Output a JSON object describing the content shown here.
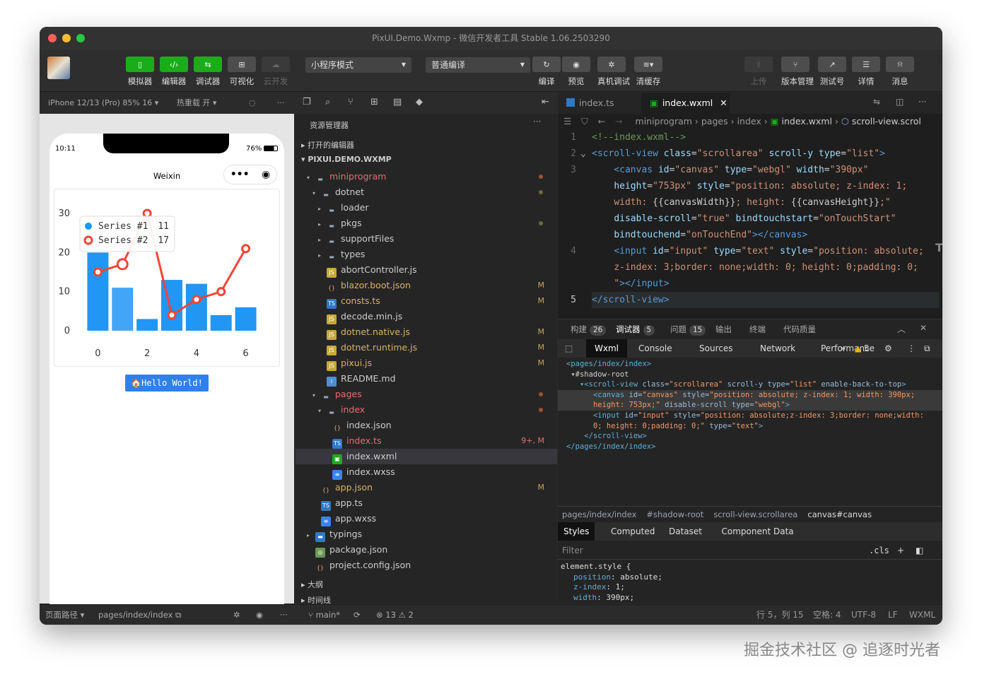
{
  "window": {
    "title": "PixUI.Demo.Wxmp - 微信开发者工具 Stable 1.06.2503290"
  },
  "toolbar": {
    "left": [
      {
        "label": "模拟器",
        "icon": "phone-icon"
      },
      {
        "label": "编辑器",
        "icon": "code-icon"
      },
      {
        "label": "调试器",
        "icon": "debug-icon"
      },
      {
        "label": "可视化",
        "icon": "layout-icon"
      },
      {
        "label": "云开发",
        "icon": "cloud-icon"
      }
    ],
    "mode_select": "小程序模式",
    "compile_select": "普通编译",
    "mid": [
      {
        "label": "编译",
        "icon": "refresh-icon"
      },
      {
        "label": "预览",
        "icon": "eye-icon"
      },
      {
        "label": "真机调试",
        "icon": "bug-icon"
      },
      {
        "label": "清缓存",
        "icon": "layers-icon"
      }
    ],
    "right": [
      {
        "label": "上传",
        "icon": "upload-icon"
      },
      {
        "label": "版本管理",
        "icon": "branch-icon"
      },
      {
        "label": "测试号",
        "icon": "external-icon"
      },
      {
        "label": "详情",
        "icon": "menu-icon"
      },
      {
        "label": "消息",
        "icon": "bell-icon"
      }
    ]
  },
  "simulator": {
    "device": "iPhone 12/13 (Pro) 85% 16 ▾",
    "hot_reload": "热重载 开 ▾",
    "time": "10:11",
    "battery": "76%",
    "nav_title": "Weixin",
    "hello_button": "🏠Hello World!",
    "footer_path_label": "页面路径 ▾",
    "footer_path": "pages/index/index"
  },
  "chart_data": {
    "type": "bar",
    "x": [
      0,
      1,
      2,
      3,
      4,
      5,
      6
    ],
    "xticks": [
      "0",
      "2",
      "4",
      "6"
    ],
    "yticks": [
      "0",
      "10",
      "20",
      "30"
    ],
    "ylim": [
      0,
      30
    ],
    "series": [
      {
        "name": "Series #1",
        "type": "bar",
        "values": [
          20,
          11,
          3,
          13,
          12,
          4,
          6
        ]
      },
      {
        "name": "Series #2",
        "type": "line",
        "values": [
          15,
          17,
          30,
          4,
          8,
          10,
          21
        ]
      }
    ],
    "tooltip": [
      {
        "label": "Series #1",
        "value": "11",
        "color": "#2196f3"
      },
      {
        "label": "Series #2",
        "value": "17",
        "color": "#f44336"
      }
    ]
  },
  "explorer": {
    "title": "资源管理器",
    "open_editors": "打开的编辑器",
    "project": "PIXUI.DEMO.WXMP",
    "items": [
      {
        "name": "miniprogram",
        "depth": 1,
        "arrow": "▾",
        "type": "folder",
        "color": "#e07070",
        "dot": true
      },
      {
        "name": "dotnet",
        "depth": 2,
        "arrow": "▾",
        "type": "folder",
        "color": "#ccc",
        "dot": true,
        "dotcolor": "#6b6b3a"
      },
      {
        "name": "loader",
        "depth": 3,
        "arrow": "▸",
        "type": "folder",
        "color": "#ccc"
      },
      {
        "name": "pkgs",
        "depth": 3,
        "arrow": "▸",
        "type": "folder",
        "color": "#ccc",
        "dot": true,
        "dotcolor": "#6b6b3a"
      },
      {
        "name": "supportFiles",
        "depth": 3,
        "arrow": "▸",
        "type": "folder",
        "color": "#ccc"
      },
      {
        "name": "types",
        "depth": 3,
        "arrow": "▸",
        "type": "folder",
        "color": "#ccc"
      },
      {
        "name": "abortController.js",
        "depth": 3,
        "type": "js",
        "color": "#ccc"
      },
      {
        "name": "blazor.boot.json",
        "depth": 3,
        "type": "json",
        "color": "#d9b26a",
        "status": "M"
      },
      {
        "name": "consts.ts",
        "depth": 3,
        "type": "ts",
        "color": "#d9b26a",
        "status": "M"
      },
      {
        "name": "decode.min.js",
        "depth": 3,
        "type": "js",
        "color": "#ccc"
      },
      {
        "name": "dotnet.native.js",
        "depth": 3,
        "type": "js",
        "color": "#d9b26a",
        "status": "M"
      },
      {
        "name": "dotnet.runtime.js",
        "depth": 3,
        "type": "js",
        "color": "#d9b26a",
        "status": "M"
      },
      {
        "name": "pixui.js",
        "depth": 3,
        "type": "js",
        "color": "#d9b26a",
        "status": "M"
      },
      {
        "name": "README.md",
        "depth": 3,
        "type": "md",
        "color": "#ccc"
      },
      {
        "name": "pages",
        "depth": 2,
        "arrow": "▾",
        "type": "folder",
        "color": "#e07070",
        "dot": true
      },
      {
        "name": "index",
        "depth": 3,
        "arrow": "▾",
        "type": "folder",
        "color": "#e07070",
        "dot": true
      },
      {
        "name": "index.json",
        "depth": 4,
        "type": "json",
        "color": "#ccc"
      },
      {
        "name": "index.ts",
        "depth": 4,
        "type": "ts",
        "color": "#e07070",
        "status": "9+, M",
        "statuscolor": "#e07070"
      },
      {
        "name": "index.wxml",
        "depth": 4,
        "type": "wxml",
        "color": "#ccc",
        "selected": true
      },
      {
        "name": "index.wxss",
        "depth": 4,
        "type": "wxss",
        "color": "#ccc"
      },
      {
        "name": "app.json",
        "depth": 2,
        "type": "json",
        "color": "#d9b26a",
        "status": "M"
      },
      {
        "name": "app.ts",
        "depth": 2,
        "type": "ts",
        "color": "#ccc"
      },
      {
        "name": "app.wxss",
        "depth": 2,
        "type": "wxss",
        "color": "#ccc"
      },
      {
        "name": "typings",
        "depth": 1,
        "arrow": "▸",
        "type": "tsfolder",
        "color": "#ccc"
      },
      {
        "name": "package.json",
        "depth": 1,
        "type": "pkg",
        "color": "#ccc"
      },
      {
        "name": "project.config.json",
        "depth": 1,
        "type": "json",
        "color": "#ccc"
      }
    ],
    "outline": "大纲",
    "timeline": "时间线",
    "branch": "main*",
    "problems": "⊗ 13 ⚠ 2"
  },
  "editor": {
    "tabs": [
      {
        "label": "index.ts",
        "active": false
      },
      {
        "label": "index.wxml",
        "active": true
      }
    ],
    "breadcrumb": [
      "miniprogram",
      "pages",
      "index",
      "index.wxml",
      "scroll-view.scrol"
    ],
    "lines": [
      {
        "n": "1",
        "html": "<span class='cm'>&lt;!--index.wxml--&gt;</span>"
      },
      {
        "n": "2",
        "html": "<span class='tg'>&lt;scroll-view</span> <span class='at'>class</span>=<span class='sv'>\"scrollarea\"</span> <span class='at'>scroll-y</span> <span class='at'>type</span>=<span class='sv'>\"list\"</span><span class='tg'>&gt;</span>"
      },
      {
        "n": "3",
        "html": "    <span class='tg'>&lt;canvas</span> <span class='at'>id</span>=<span class='sv'>\"canvas\"</span> <span class='at'>type</span>=<span class='sv'>\"webgl\"</span> <span class='at'>width</span>=<span class='sv'>\"390px\"</span>"
      },
      {
        "n": "",
        "html": "    <span class='at'>height</span>=<span class='sv'>\"753px\"</span> <span class='at'>style</span>=<span class='sv'>\"position: absolute; z-index: 1;</span>"
      },
      {
        "n": "",
        "html": "    <span class='sv'>width: </span>{{canvasWidth}}<span class='sv'>; height: </span>{{canvasHeight}}<span class='sv'>;\"</span>"
      },
      {
        "n": "",
        "html": "    <span class='at'>disable-scroll</span>=<span class='sv'>\"true\"</span> <span class='at'>bindtouchstart</span>=<span class='sv'>\"onTouchStart\"</span>"
      },
      {
        "n": "",
        "html": "    <span class='at'>bindtouchend</span>=<span class='sv'>\"onTouchEnd\"</span><span class='tg'>&gt;&lt;/canvas&gt;</span>"
      },
      {
        "n": "4",
        "html": "    <span class='tg'>&lt;input</span> <span class='at'>id</span>=<span class='sv'>\"input\"</span> <span class='at'>type</span>=<span class='sv'>\"text\"</span> <span class='at'>style</span>=<span class='sv'>\"position: absolute;</span>"
      },
      {
        "n": "",
        "html": "    <span class='sv'>z-index: 3;border: none;width: 0; height: 0;padding: 0;</span>"
      },
      {
        "n": "",
        "html": "    <span class='sv'>\"</span><span class='tg'>&gt;&lt;/input&gt;</span>"
      },
      {
        "n": "5",
        "html": "<span class='tg'>&lt;/scroll-view&gt;</span>"
      }
    ]
  },
  "panel": {
    "tabs": [
      {
        "label": "构建",
        "count": "26"
      },
      {
        "label": "调试器",
        "count": "5",
        "active": true
      },
      {
        "label": "问题",
        "count": "15"
      },
      {
        "label": "输出"
      },
      {
        "label": "终端"
      },
      {
        "label": "代码质量"
      }
    ],
    "devtabs": [
      "Wxml",
      "Console",
      "Sources",
      "Network",
      "Performance"
    ],
    "warn_count": "5",
    "dom_lines": [
      "<span class='dtag'>&lt;pages/index/index&gt;</span>",
      " <span style='color:#ccc'>▾#shadow-root</span>",
      "   <span class='dtag'>▾&lt;scroll-view</span> <span class='dat'>class=</span><span class='dval'>\"scrollarea\"</span> <span class='dat'>scroll-y type=</span><span class='dval'>\"list\"</span> <span class='dat'>enable-back-to-top</span><span class='dtag'>&gt;</span>",
      "      <span class='dtag'>&lt;canvas</span> <span class='dat'>id=</span><span class='dval'>\"canvas\"</span> <span class='dat'>style=</span><span class='dval'>\"position: absolute; z-index: 1; width: 390px;</span>",
      "      <span class='dval'>height: 753px;\"</span> <span class='dat'>disable-scroll type=</span><span class='dval'>\"webgl\"</span><span class='dtag'>&gt;</span>",
      "      <span class='dtag'>&lt;input</span> <span class='dat'>id=</span><span class='dval'>\"input\"</span> <span class='dat'>style=</span><span class='dval'>\"position: absolute;z-index: 3;border: none;width:</span>",
      "      <span class='dval'>0; height: 0;padding: 0;\"</span> <span class='dat'>type=</span><span class='dval'>\"text\"</span><span class='dtag'>&gt;</span>",
      "    <span class='dtag'>&lt;/scroll-view&gt;</span>",
      "<span class='dtag'>&lt;/pages/index/index&gt;</span>"
    ],
    "dom_crumb": [
      "pages/index/index",
      "#shadow-root",
      "scroll-view.scrollarea",
      "canvas#canvas"
    ],
    "style_tabs": [
      "Styles",
      "Computed",
      "Dataset",
      "Component Data"
    ],
    "filter": "Filter",
    "cls": ".cls",
    "styles": [
      {
        "text": "element.style {",
        "indent": false
      },
      {
        "prop": "position",
        "val": "absolute"
      },
      {
        "prop": "z-index",
        "val": "1"
      },
      {
        "prop": "width",
        "val": "390px"
      }
    ]
  },
  "statusbar": {
    "pos": "行 5，列 15",
    "spaces": "空格: 4",
    "encoding": "UTF-8",
    "eol": "LF",
    "lang": "WXML"
  },
  "watermark": "掘金技术社区 @ 追逐时光者",
  "colors": {
    "green": "#1aad19",
    "blue": "#2196f3",
    "red": "#f44336",
    "bg": "#2b2b2b"
  }
}
